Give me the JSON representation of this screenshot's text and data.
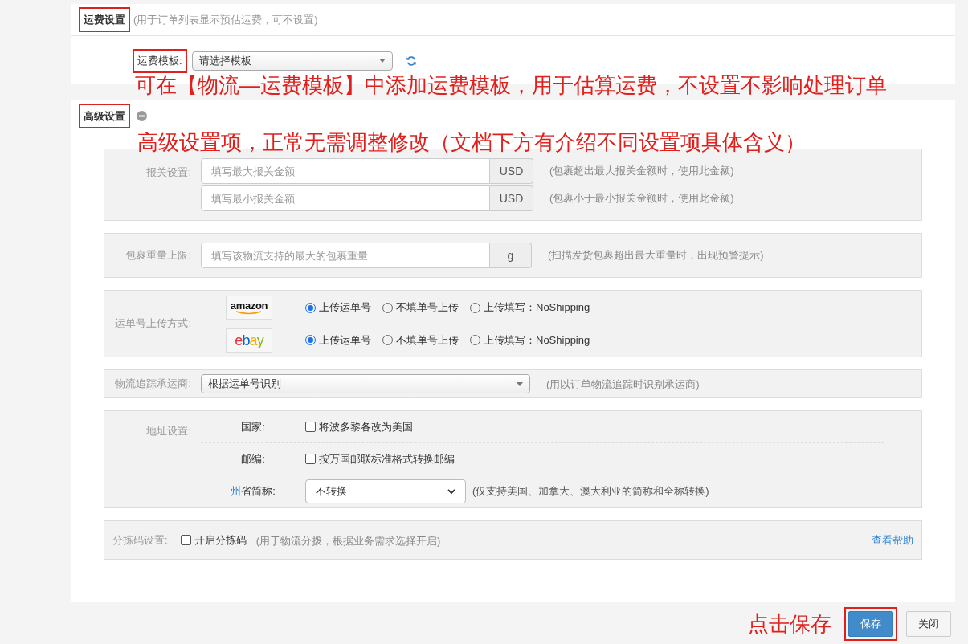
{
  "shipping_section": {
    "title": "运费设置",
    "title_highlighted": true,
    "hint": "(用于订单列表显示预估运费，可不设置)",
    "template_label": "运费模板:",
    "template_label_highlighted": true,
    "template_value": "请选择模板"
  },
  "advanced_section": {
    "title": "高级设置",
    "title_highlighted": true,
    "customs": {
      "label": "报关设置:",
      "rows": [
        {
          "placeholder": "填写最大报关金额",
          "unit": "USD",
          "hint": "(包裹超出最大报关金额时，使用此金额)"
        },
        {
          "placeholder": "填写最小报关金额",
          "unit": "USD",
          "hint": "(包裹小于最小报关金额时，使用此金额)"
        }
      ]
    },
    "weight": {
      "label": "包裹重量上限:",
      "placeholder": "填写该物流支持的最大的包裹重量",
      "unit": "g",
      "hint": "(扫描发货包裹超出最大重量时，出现预警提示)"
    },
    "upload": {
      "label": "运单号上传方式:",
      "platforms": [
        {
          "logo": "amazon",
          "kind": "amazon",
          "options": [
            {
              "label": "上传运单号",
              "selected": true
            },
            {
              "label": "不填单号上传",
              "selected": false
            },
            {
              "label": "上传填写：NoShipping",
              "selected": false
            }
          ]
        },
        {
          "logo": "ebay",
          "kind": "ebay",
          "options": [
            {
              "label": "上传运单号",
              "selected": true
            },
            {
              "label": "不填单号上传",
              "selected": false
            },
            {
              "label": "上传填写：NoShipping",
              "selected": false
            }
          ]
        }
      ]
    },
    "tracker": {
      "label": "物流追踪承运商:",
      "value": "根据运单号识别",
      "hint": "(用以订单物流追踪时识别承运商)"
    },
    "address": {
      "label": "地址设置:",
      "rows": [
        {
          "kind": "checkbox",
          "label": "国家:",
          "option": "将波多黎各改为美国",
          "checked": false
        },
        {
          "kind": "checkbox",
          "label": "邮编:",
          "option": "按万国邮联标准格式转换邮编",
          "checked": false
        },
        {
          "kind": "select",
          "label_link": "州",
          "label": "省简称:",
          "value": "不转换",
          "hint": "(仅支持美国、加拿大、澳大利亚的简称和全称转换)"
        }
      ]
    },
    "sorting": {
      "label": "分拣码设置:",
      "option": "开启分拣码",
      "checked": false,
      "hint": "(用于物流分拨，根据业务需求选择开启)",
      "help": "查看帮助"
    }
  },
  "annotations": [
    "可在【物流—运费模板】中添加运费模板，用于估算运费，不设置不影响处理订单",
    "高级设置项，正常无需调整修改（文档下方有介绍不同设置项具体含义）",
    "点击保存"
  ],
  "buttons": [
    {
      "label": "保存",
      "kind": "primary",
      "highlighted": true
    },
    {
      "label": "关闭",
      "kind": "default",
      "highlighted": false
    }
  ]
}
